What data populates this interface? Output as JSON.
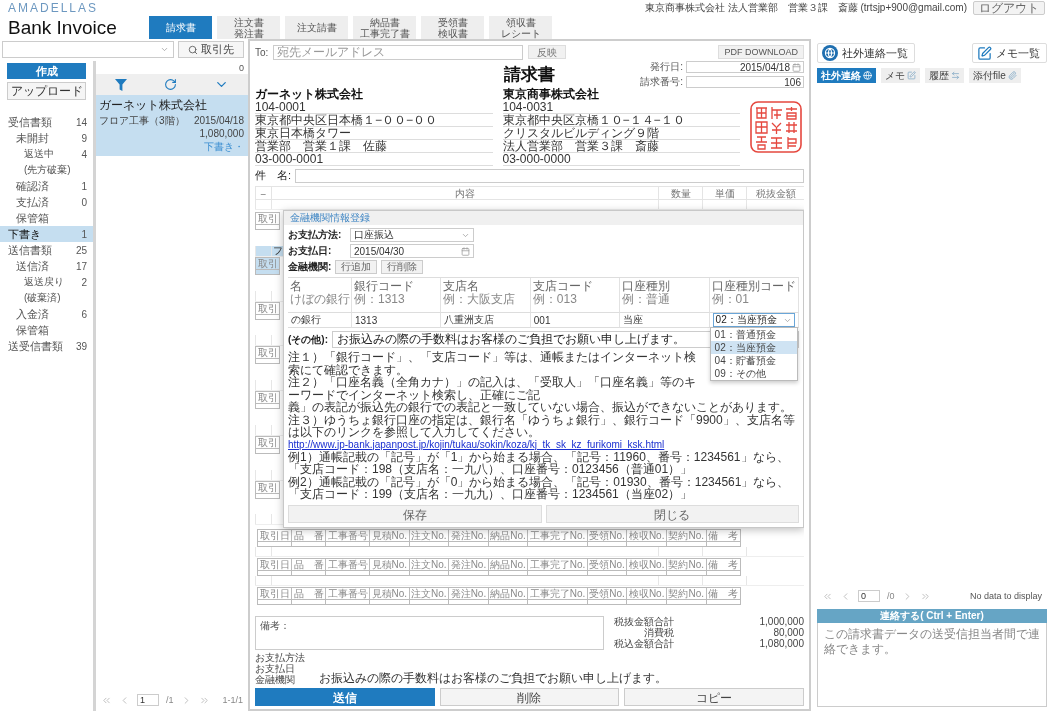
{
  "app": {
    "logo": "AMADELLAS",
    "user": "東京商事株式会社 法人営業部　営業３課　斎藤 (trtsjp+900@gmail.com)",
    "logout": "ログアウト",
    "title": "Bank Invoice"
  },
  "doc_tabs": [
    {
      "lines": [
        "請求書"
      ],
      "selected": true
    },
    {
      "lines": [
        "注文書",
        "発注書"
      ],
      "selected": false
    },
    {
      "lines": [
        "注文請書"
      ],
      "selected": false
    },
    {
      "lines": [
        "納品書",
        "工事完了書"
      ],
      "selected": false
    },
    {
      "lines": [
        "受領書",
        "検収書"
      ],
      "selected": false
    },
    {
      "lines": [
        "領収書",
        "レシート"
      ],
      "selected": false
    }
  ],
  "partner_search": {
    "button": "取引先"
  },
  "sidebar": {
    "create": "作成",
    "upload": "アップロード",
    "folders": [
      {
        "label": "受信書類",
        "count": "14",
        "selected": false,
        "children": [
          {
            "label": "未開封",
            "count": "9",
            "selected": false,
            "children": [
              {
                "label": "返送中",
                "count": "4",
                "selected": false
              },
              {
                "label": "(先方破棄)",
                "selected": false
              }
            ]
          },
          {
            "label": "確認済",
            "count": "1",
            "selected": false
          },
          {
            "label": "支払済",
            "count": "0",
            "selected": false
          },
          {
            "label": "保管箱",
            "selected": false
          }
        ]
      },
      {
        "label": "下書き",
        "count": "1",
        "selected": true
      },
      {
        "label": "送信書類",
        "count": "25",
        "selected": false,
        "children": [
          {
            "label": "送信済",
            "count": "17",
            "selected": false,
            "children": [
              {
                "label": "返送戻り",
                "count": "2",
                "selected": false
              },
              {
                "label": "(破棄済)",
                "selected": false
              }
            ]
          },
          {
            "label": "入金済",
            "count": "6",
            "selected": false
          },
          {
            "label": "保管箱",
            "selected": false
          }
        ]
      },
      {
        "label": "送受信書類",
        "count": "39",
        "selected": false
      }
    ]
  },
  "document_list": {
    "count": "0",
    "items": [
      {
        "company": "ガーネット株式会社",
        "subject": "フロア工事（3階）",
        "date": "2015/04/18",
        "amount": "1,080,000",
        "status": "下書き・",
        "selected": true
      }
    ],
    "pagination": {
      "page": "1",
      "total": "/1",
      "range": "1-1/1"
    }
  },
  "invoice": {
    "to_label": "To:",
    "to_placeholder": "宛先メールアドレス",
    "reflect_button": "反映",
    "pdf_button": "PDF DOWNLOAD",
    "title": "請求書",
    "issue_date": {
      "label": "発行日:",
      "value": "2015/04/18"
    },
    "number": {
      "label": "請求番号:",
      "value": "106"
    },
    "sender": {
      "name": "ガーネット株式会社",
      "lines": [
        "104-0001",
        "東京都中央区日本橋１−００−００",
        "東京日本橋タワー",
        "営業部　営業１課　佐藤",
        "03-000-0001"
      ]
    },
    "recipient": {
      "name": "東京商事株式会社",
      "lines": [
        "104-0031",
        "東京都中央区京橋１０−１４−１０",
        "クリスタルビルディング９階",
        "法人営業部　営業３課　斎藤",
        "03-000-0000"
      ]
    },
    "subject_label": "件　名:",
    "columns": [
      "−",
      "内容",
      "数量",
      "単価",
      "税抜金額"
    ],
    "blocks": [
      {
        "selected": false,
        "row_covered": false,
        "details_covered": true,
        "details": [
          "取引"
        ]
      },
      {
        "selected": true,
        "row_covered": true,
        "details_covered": true,
        "content": "フ",
        "details": [
          "取引"
        ]
      },
      {
        "selected": false,
        "row_covered": true,
        "details_covered": true,
        "details": [
          "取引"
        ]
      },
      {
        "selected": false,
        "row_covered": true,
        "details_covered": true,
        "details": [
          "取引"
        ]
      },
      {
        "selected": false,
        "row_covered": true,
        "details_covered": true,
        "details": [
          "取引"
        ]
      },
      {
        "selected": false,
        "row_covered": true,
        "details_covered": true,
        "details": [
          "取引"
        ]
      },
      {
        "selected": false,
        "row_covered": true,
        "details_covered": true,
        "details": [
          "取引"
        ]
      },
      {
        "selected": false,
        "row_covered": true,
        "details_covered": false,
        "details": [
          "取引日",
          "品　番",
          "工事番号",
          "見積No.",
          "注文No.",
          "発注No.",
          "納品No.",
          "工事完了No.",
          "受領No.",
          "検収No.",
          "契約No.",
          "備　考"
        ]
      },
      {
        "selected": false,
        "row_covered": false,
        "details_covered": false,
        "details": [
          "取引日",
          "品　番",
          "工事番号",
          "見積No.",
          "注文No.",
          "発注No.",
          "納品No.",
          "工事完了No.",
          "受領No.",
          "検収No.",
          "契約No.",
          "備　考"
        ]
      },
      {
        "selected": false,
        "row_covered": false,
        "details_covered": false,
        "details": [
          "取引日",
          "品　番",
          "工事番号",
          "見積No.",
          "注文No.",
          "発注No.",
          "納品No.",
          "工事完了No.",
          "受領No.",
          "検収No.",
          "契約No.",
          "備　考"
        ]
      }
    ],
    "remarks_label": "備考：",
    "totals": [
      {
        "label": "税抜金額合計",
        "value": "1,000,000"
      },
      {
        "label": "消費税",
        "value": "80,000"
      },
      {
        "label": "税込金額合計",
        "value": "1,080,000"
      }
    ],
    "payment_lines": [
      "お支払方法",
      "お支払日",
      "金融機関"
    ],
    "fee_note": "お振込みの際の手数料はお客様のご負担でお願い申し上げます。",
    "actions": [
      {
        "label": "送信",
        "kind": "primary"
      },
      {
        "label": "削除",
        "kind": "default"
      },
      {
        "label": "コピー",
        "kind": "default"
      }
    ]
  },
  "bank_dialog": {
    "title": "金融機関情報登録",
    "method": {
      "label": "お支払方法:",
      "value": "口座振込"
    },
    "date": {
      "label": "お支払日:",
      "value": "2015/04/30"
    },
    "institution_label": "金融機関:",
    "row_buttons": [
      "行追加",
      "行削除"
    ],
    "columns": [
      {
        "label": "名",
        "example": "けぼの銀行"
      },
      {
        "label": "銀行コード",
        "example": "例：1313"
      },
      {
        "label": "支店名",
        "example": "例：大阪支店"
      },
      {
        "label": "支店コード",
        "example": "例：013"
      },
      {
        "label": "口座種別",
        "example": "例：普通"
      },
      {
        "label": "口座種別コード",
        "example": "例：01"
      }
    ],
    "values": [
      {
        "kind": "text",
        "text": "の銀行"
      },
      {
        "kind": "text",
        "text": "1313"
      },
      {
        "kind": "text",
        "text": "八重洲支店"
      },
      {
        "kind": "text",
        "text": "001"
      },
      {
        "kind": "text",
        "text": "当座"
      },
      {
        "kind": "select",
        "text": "02：当座預金"
      }
    ],
    "options": [
      {
        "label": "01：普通預金",
        "selected": false
      },
      {
        "label": "02：当座預金",
        "selected": true
      },
      {
        "label": "04：貯蓄預金",
        "selected": false
      },
      {
        "label": "09：その他",
        "selected": false
      }
    ],
    "other": {
      "label": "(その他):",
      "value": "お振込みの際の手数料はお客様のご負担でお願い申し上げます。"
    },
    "notes": [
      {
        "kind": "text",
        "text": "注１）「銀行コード」、「支店コード」等は、通帳またはインターネット検索にて確認できます。"
      },
      {
        "kind": "text",
        "text": "注２）「口座名義（全角カナ）」の記入は、「受取人」「口座名義」等のキーワードでインターネット検索し、正確にご記"
      },
      {
        "kind": "text",
        "text": "義」の表記が振込先の銀行での表記と一致していない場合、振込ができないことがあります。"
      },
      {
        "kind": "text",
        "text": "注３）ゆうちょ銀行口座の指定は、銀行名「ゆうちょ銀行」、銀行コード「9900」、支店名等は以下のリンクを参照して入力してください。"
      },
      {
        "kind": "link",
        "text": "http://www.jp-bank.japanpost.jp/kojin/tukau/sokin/koza/kj_tk_sk_kz_furikomi_ksk.html"
      },
      {
        "kind": "text",
        "text": "例1）通帳記載の「記号」が「1」から始まる場合、「記号：11960、番号：1234561」なら、「支店コード：198（支店名：一九八）、口座番号：0123456（普通01）」"
      },
      {
        "kind": "text",
        "text": "例2）通帳記載の「記号」が「0」から始まる場合、「記号：01930、番号：1234561」なら、「支店コード：199（支店名：一九九）、口座番号：1234561（当座02）」"
      }
    ],
    "buttons": [
      "保存",
      "閉じる"
    ]
  },
  "contact_panel": {
    "list_button": "社外連絡一覧",
    "memo_button": "メモ一覧",
    "tabs": [
      {
        "label": "社外連絡",
        "selected": true
      },
      {
        "label": "メモ",
        "selected": false
      },
      {
        "label": "履歴",
        "selected": false
      },
      {
        "label": "添付file",
        "selected": false
      }
    ],
    "pagination": {
      "page": "0",
      "total": "/0"
    },
    "empty_text": "No data to display",
    "send_bar": "連絡する( Ctrl + Enter)",
    "message_placeholder": "この請求書データの送受信担当者間で連絡できます。"
  }
}
